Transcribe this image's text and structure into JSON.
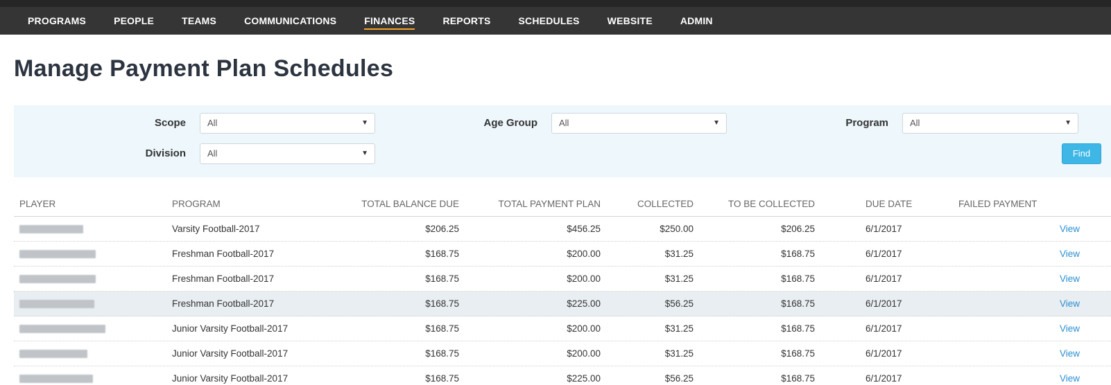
{
  "nav": {
    "items": [
      {
        "label": "PROGRAMS",
        "active": false
      },
      {
        "label": "PEOPLE",
        "active": false
      },
      {
        "label": "TEAMS",
        "active": false
      },
      {
        "label": "COMMUNICATIONS",
        "active": false
      },
      {
        "label": "FINANCES",
        "active": true
      },
      {
        "label": "REPORTS",
        "active": false
      },
      {
        "label": "SCHEDULES",
        "active": false
      },
      {
        "label": "WEBSITE",
        "active": false
      },
      {
        "label": "ADMIN",
        "active": false
      }
    ],
    "active_color": "#f5a623"
  },
  "page": {
    "title": "Manage Payment Plan Schedules"
  },
  "filters": {
    "scope": {
      "label": "Scope",
      "value": "All"
    },
    "age_group": {
      "label": "Age Group",
      "value": "All"
    },
    "program": {
      "label": "Program",
      "value": "All"
    },
    "division": {
      "label": "Division",
      "value": "All"
    },
    "find_label": "Find"
  },
  "table": {
    "headers": {
      "player": "PLAYER",
      "program": "PROGRAM",
      "balance": "TOTAL BALANCE DUE",
      "plan": "TOTAL PAYMENT PLAN",
      "collected": "COLLECTED",
      "to_be_collected": "TO BE COLLECTED",
      "due_date": "DUE DATE",
      "failed": "FAILED PAYMENT"
    },
    "view_label": "View",
    "rows": [
      {
        "program": "Varsity Football-2017",
        "balance": "$206.25",
        "plan": "$456.25",
        "collected": "$250.00",
        "to_be": "$206.25",
        "due": "6/1/2017",
        "view": "View"
      },
      {
        "program": "Freshman Football-2017",
        "balance": "$168.75",
        "plan": "$200.00",
        "collected": "$31.25",
        "to_be": "$168.75",
        "due": "6/1/2017",
        "view": "View"
      },
      {
        "program": "Freshman Football-2017",
        "balance": "$168.75",
        "plan": "$200.00",
        "collected": "$31.25",
        "to_be": "$168.75",
        "due": "6/1/2017",
        "view": "View"
      },
      {
        "program": "Freshman Football-2017",
        "balance": "$168.75",
        "plan": "$225.00",
        "collected": "$56.25",
        "to_be": "$168.75",
        "due": "6/1/2017",
        "view": "View"
      },
      {
        "program": "Junior Varsity Football-2017",
        "balance": "$168.75",
        "plan": "$200.00",
        "collected": "$31.25",
        "to_be": "$168.75",
        "due": "6/1/2017",
        "view": "View"
      },
      {
        "program": "Junior Varsity Football-2017",
        "balance": "$168.75",
        "plan": "$200.00",
        "collected": "$31.25",
        "to_be": "$168.75",
        "due": "6/1/2017",
        "view": "View"
      },
      {
        "program": "Junior Varsity Football-2017",
        "balance": "$168.75",
        "plan": "$225.00",
        "collected": "$56.25",
        "to_be": "$168.75",
        "due": "6/1/2017",
        "view": "View"
      }
    ]
  }
}
